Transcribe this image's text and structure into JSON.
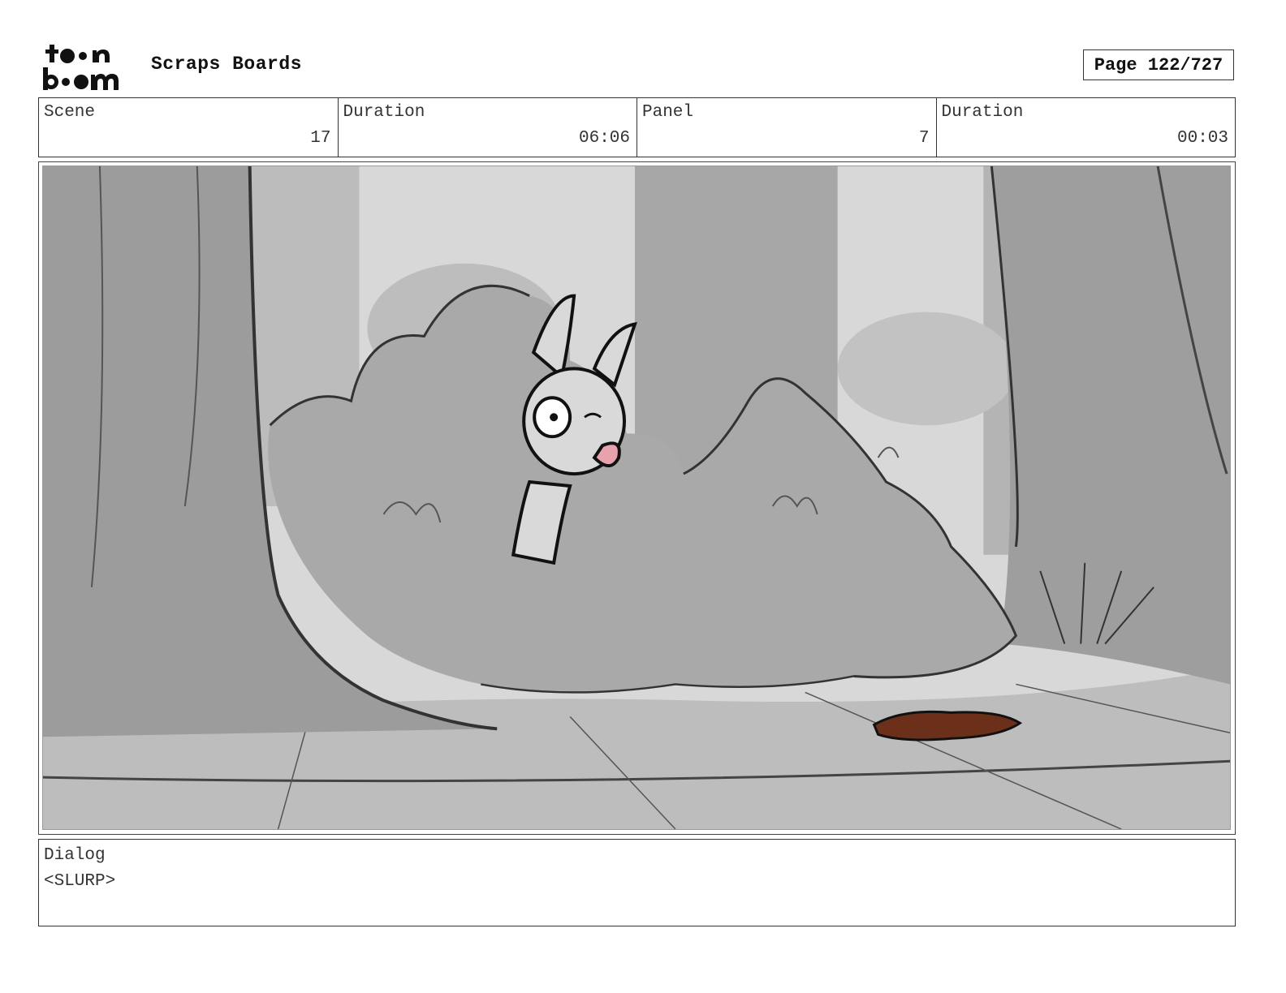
{
  "header": {
    "logo_text": "toon boom",
    "title": "Scraps Boards",
    "page_label": "Page 122/727"
  },
  "info": {
    "scene_label": "Scene",
    "scene_value": "17",
    "scene_duration_label": "Duration",
    "scene_duration_value": "06:06",
    "panel_label": "Panel",
    "panel_value": "7",
    "panel_duration_label": "Duration",
    "panel_duration_value": "00:03"
  },
  "dialog": {
    "label": "Dialog",
    "text": "<SLURP>"
  },
  "colors": {
    "sky": "#d7d7d7",
    "tree": "#9a9a9a",
    "bush": "#a8a8a8",
    "ground": "#bdbdbd",
    "tongue": "#e8a2ad",
    "puddle": "#6b2f1a"
  }
}
